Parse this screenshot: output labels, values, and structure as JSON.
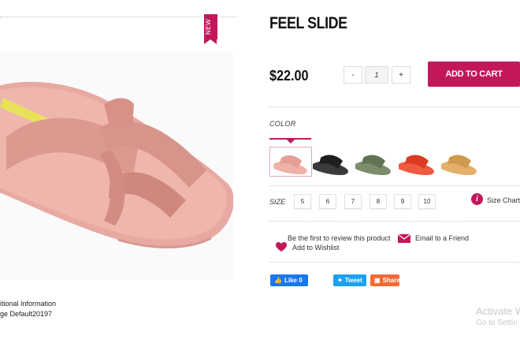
{
  "badge": {
    "new_label": "NEW"
  },
  "product": {
    "title": "FEEL SLIDE",
    "price": "$22.00",
    "add_to_cart_label": "ADD TO CART",
    "quantity": {
      "minus": "-",
      "value": "1",
      "plus": "+"
    }
  },
  "info": {
    "line1": "itional Information",
    "line2": "ge Default20197"
  },
  "color": {
    "label": "COLOR",
    "swatches": [
      {
        "name": "pink",
        "hex": "#e9a79f"
      },
      {
        "name": "black",
        "hex": "#2b2b2b"
      },
      {
        "name": "olive",
        "hex": "#6f8060"
      },
      {
        "name": "red",
        "hex": "#e8452d"
      },
      {
        "name": "tan",
        "hex": "#d9a55e"
      }
    ],
    "selected_index": 0
  },
  "size": {
    "label": "SIZE",
    "options": [
      "5",
      "6",
      "7",
      "8",
      "9",
      "10"
    ],
    "chart_label": "Size Chart"
  },
  "links": {
    "review": "Be the first to review this product",
    "email": "Email to a Friend",
    "wishlist": "Add to Wishlist"
  },
  "social": {
    "like": "Like 0",
    "tweet": "Tweet",
    "share": "Share"
  },
  "watermark": {
    "title": "Activate W",
    "subtitle": "Go to Settin"
  },
  "colors": {
    "accent": "#c2185b",
    "facebook": "#1877f2",
    "twitter": "#1da1f2",
    "share": "#f06a35"
  }
}
